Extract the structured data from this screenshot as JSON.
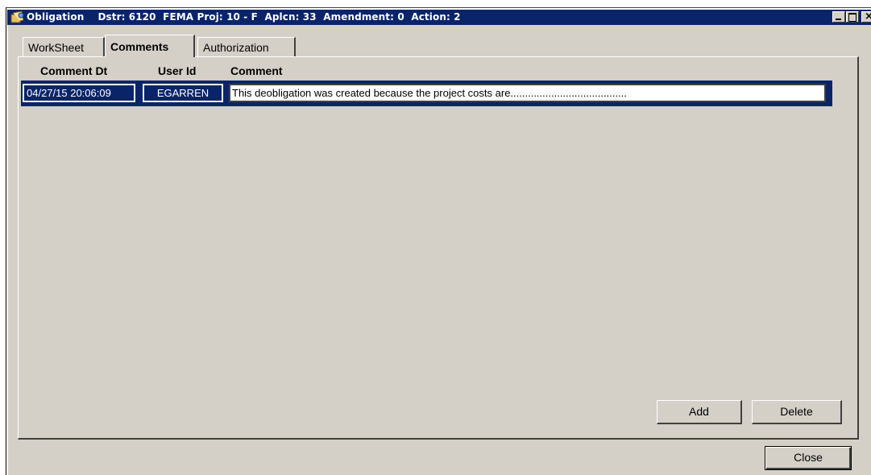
{
  "window": {
    "title": "Obligation    Dstr: 6120  FEMA Proj: 10 - F  Aplcn: 33  Amendment: 0  Action: 2",
    "buttons": [
      "minimize-icon",
      "maximize-icon",
      "close-icon"
    ]
  },
  "tabs": [
    {
      "label": "WorkSheet",
      "active": false
    },
    {
      "label": "Comments",
      "active": true
    },
    {
      "label": "Authorization",
      "active": false
    }
  ],
  "comments": {
    "columns": [
      "Comment Dt",
      "User Id",
      "Comment"
    ],
    "rows": [
      {
        "date": "04/27/15 20:06:09",
        "user": "EGARREN",
        "comment": "This deobligation was created because the project costs are........................................"
      }
    ]
  },
  "actions": {
    "add_label": "Add",
    "delete_label": "Delete",
    "close_label": "Close"
  },
  "colors": {
    "titlebar": "#0a246a",
    "face": "#d4d0c8",
    "selection": "#0a246a"
  }
}
